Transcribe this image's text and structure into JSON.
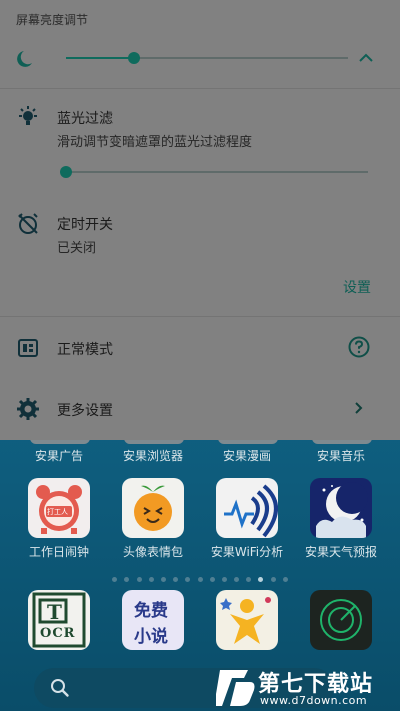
{
  "panel": {
    "header": "屏幕亮度调节",
    "brightness_level": 0.24,
    "blue_filter": {
      "title": "蓝光过滤",
      "subtitle": "滑动调节变暗遮罩的蓝光过滤程度",
      "level": 0.0
    },
    "timer": {
      "title": "定时开关",
      "status": "已关闭",
      "settings_link": "设置"
    },
    "mode": {
      "label": "正常模式"
    },
    "more": {
      "label": "更多设置"
    }
  },
  "home": {
    "top_row_labels": [
      "安果广告",
      "安果浏览器",
      "安果漫画",
      "安果音乐"
    ],
    "apps": [
      {
        "label": "工作日闹钟",
        "icon": "alarm-clock-icon"
      },
      {
        "label": "头像表情包",
        "icon": "emoji-orange-icon"
      },
      {
        "label": "安果WiFi分析",
        "icon": "wifi-analyzer-icon"
      },
      {
        "label": "安果天气预报",
        "icon": "weather-moon-icon"
      }
    ],
    "alarm_badge": "打工人",
    "dock": [
      {
        "icon": "ocr-icon",
        "text": "OCR"
      },
      {
        "icon": "free-novel-icon",
        "text_line1": "免费",
        "text_line2": "小说"
      },
      {
        "icon": "star-person-icon"
      },
      {
        "icon": "radar-icon"
      }
    ],
    "page_count": 15,
    "active_page": 12,
    "search_icon": "search-icon"
  },
  "watermark": {
    "text": "第七下载站",
    "url": "www.d7down.com"
  }
}
